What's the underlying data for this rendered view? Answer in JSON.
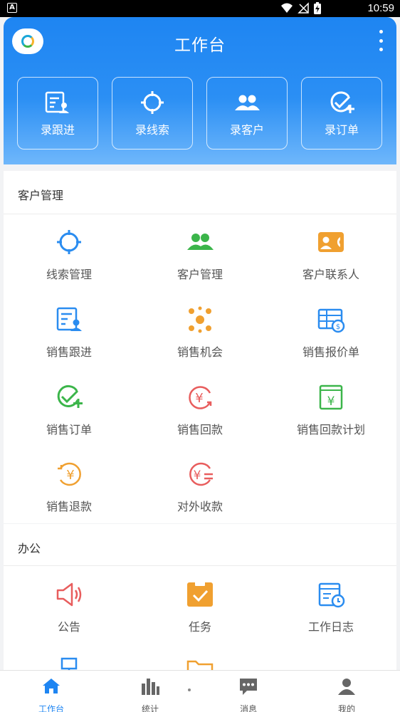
{
  "status_bar": {
    "time": "10:59"
  },
  "header": {
    "title": "工作台"
  },
  "quick_actions": [
    {
      "label": "录跟进",
      "icon": "follow-up-icon"
    },
    {
      "label": "录线索",
      "icon": "target-icon"
    },
    {
      "label": "录客户",
      "icon": "customers-icon"
    },
    {
      "label": "录订单",
      "icon": "check-plus-icon"
    }
  ],
  "customer_section": {
    "title": "客户管理",
    "items": [
      {
        "label": "线索管理",
        "icon": "target-icon",
        "color": "#2a8cf0"
      },
      {
        "label": "客户管理",
        "icon": "customers-icon",
        "color": "#3bb54a"
      },
      {
        "label": "客户联系人",
        "icon": "contact-card-icon",
        "color": "#f0a030"
      },
      {
        "label": "销售跟进",
        "icon": "follow-up-icon",
        "color": "#2a8cf0"
      },
      {
        "label": "销售机会",
        "icon": "network-icon",
        "color": "#f0a030"
      },
      {
        "label": "销售报价单",
        "icon": "quote-sheet-icon",
        "color": "#2a8cf0"
      },
      {
        "label": "销售订单",
        "icon": "check-plus-icon",
        "color": "#3bb54a"
      },
      {
        "label": "销售回款",
        "icon": "yen-refresh-icon",
        "color": "#e85d5d"
      },
      {
        "label": "销售回款计划",
        "icon": "yen-calendar-icon",
        "color": "#3bb54a"
      },
      {
        "label": "销售退款",
        "icon": "yen-refund-icon",
        "color": "#f0a030"
      },
      {
        "label": "对外收款",
        "icon": "yen-transfer-icon",
        "color": "#e85d5d"
      }
    ]
  },
  "office_section": {
    "title": "办公",
    "items": [
      {
        "label": "公告",
        "icon": "megaphone-icon",
        "color": "#e85d5d"
      },
      {
        "label": "任务",
        "icon": "task-clipboard-icon",
        "color": "#f0a030"
      },
      {
        "label": "工作日志",
        "icon": "work-log-icon",
        "color": "#2a8cf0"
      }
    ]
  },
  "bottom_nav": [
    {
      "label": "工作台",
      "icon": "home-icon",
      "active": true
    },
    {
      "label": "统计",
      "icon": "bar-chart-icon",
      "active": false
    },
    {
      "label": "消息",
      "icon": "message-icon",
      "active": false
    },
    {
      "label": "我的",
      "icon": "user-icon",
      "active": false
    }
  ]
}
